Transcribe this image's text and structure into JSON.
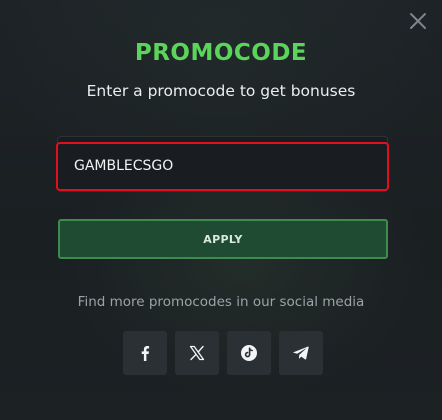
{
  "modal": {
    "title": "PROMOCODE",
    "subtitle": "Enter a promocode to get bonuses",
    "promo_input": {
      "value": "GAMBLECSGO",
      "placeholder": ""
    },
    "apply_label": "APPLY",
    "social_text": "Find more promocodes in our social media",
    "socials": [
      {
        "icon": "facebook-icon"
      },
      {
        "icon": "x-twitter-icon"
      },
      {
        "icon": "tiktok-icon"
      },
      {
        "icon": "telegram-icon"
      }
    ],
    "close_icon": "close-icon"
  },
  "colors": {
    "title_green": "#5cd35a",
    "input_error_border": "#e0101d",
    "apply_bg": "#1f4b33",
    "apply_border": "#3e8b4f",
    "social_button_bg": "#2b3034"
  }
}
